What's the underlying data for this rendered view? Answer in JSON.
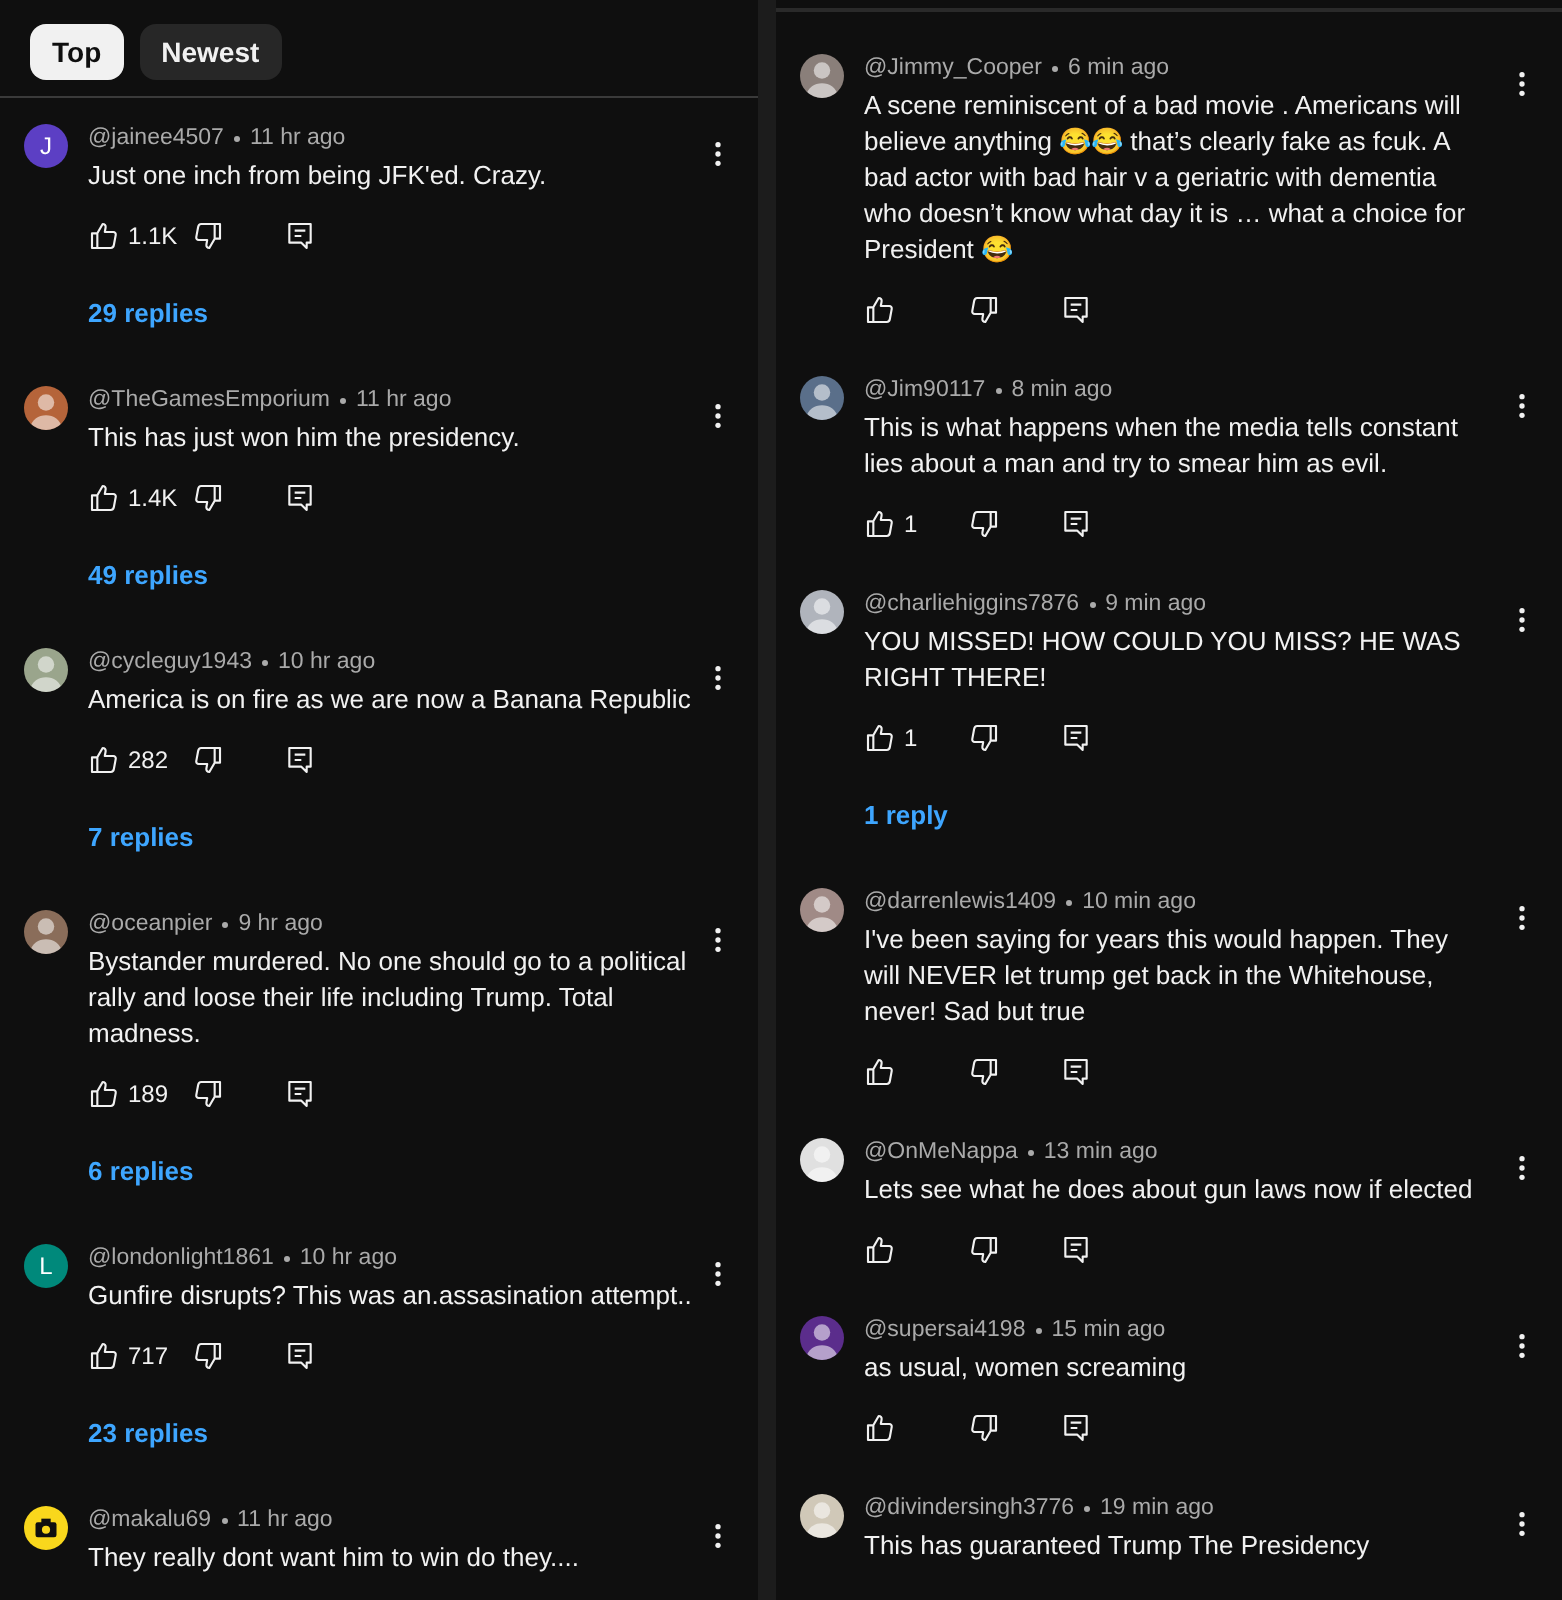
{
  "left_panel": {
    "sort_tabs": [
      {
        "label": "Top",
        "selected": true
      },
      {
        "label": "Newest",
        "selected": false
      }
    ],
    "comments": [
      {
        "author": "@jainee4507",
        "time": "11 hr ago",
        "avatar": {
          "kind": "letter",
          "letter": "J",
          "color": "#5c3fc4"
        },
        "text": "Just one inch from being JFK'ed. Crazy.",
        "likes": "1.1K",
        "replies": "29 replies"
      },
      {
        "author": "@TheGamesEmporium",
        "time": "11 hr ago",
        "avatar": {
          "kind": "photo",
          "color": "#b5643a"
        },
        "text": "This has just won him the presidency.",
        "likes": "1.4K",
        "replies": "49 replies"
      },
      {
        "author": "@cycleguy1943",
        "time": "10 hr ago",
        "avatar": {
          "kind": "photo",
          "color": "#9aa58c"
        },
        "text": "America is on fire as we are now a Banana Republic",
        "likes": "282",
        "replies": "7 replies"
      },
      {
        "author": "@oceanpier",
        "time": "9 hr ago",
        "avatar": {
          "kind": "photo",
          "color": "#8a6d5a"
        },
        "text": "Bystander murdered. No one should go to a political rally and loose their life including Trump. Total madness.",
        "likes": "189",
        "replies": "6 replies"
      },
      {
        "author": "@londonlight1861",
        "time": "10 hr ago",
        "avatar": {
          "kind": "letter",
          "letter": "L",
          "color": "#00897b"
        },
        "text": "Gunfire disrupts? This was an.assasination attempt..",
        "likes": "717",
        "replies": "23 replies"
      },
      {
        "author": "@makalu69",
        "time": "11 hr ago",
        "avatar": {
          "kind": "camera",
          "color": "#f9d71c"
        },
        "text": "They really dont want him to win do they...."
      }
    ]
  },
  "right_panel": {
    "comments": [
      {
        "author": "@Jimmy_Cooper",
        "time": "6 min ago",
        "avatar": {
          "kind": "photo",
          "color": "#8a7f7a"
        },
        "text": "A scene reminiscent of a bad movie . Americans will believe anything 😂😂 that’s clearly fake as fcuk. A bad actor with bad hair v a  geriatric with dementia who doesn’t know what day it is … what a choice for President 😂",
        "actions": true
      },
      {
        "author": "@Jim90117",
        "time": "8 min ago",
        "avatar": {
          "kind": "photo",
          "color": "#5a6f8a"
        },
        "text": "This is what happens when the media tells constant lies about a man and try to smear him as evil.",
        "likes": "1"
      },
      {
        "author": "@charliehiggins7876",
        "time": "9 min ago",
        "avatar": {
          "kind": "photo",
          "color": "#b0b4bc"
        },
        "text": "YOU MISSED! HOW COULD YOU MISS? HE WAS RIGHT THERE!",
        "likes": "1",
        "replies": "1 reply"
      },
      {
        "author": "@darrenlewis1409",
        "time": "10 min ago",
        "avatar": {
          "kind": "photo",
          "color": "#a08a86"
        },
        "text": "I've been saying for years this would happen. They will NEVER let trump get back in the Whitehouse, never! Sad but true",
        "actions": true
      },
      {
        "author": "@OnMeNappa",
        "time": "13 min ago",
        "avatar": {
          "kind": "photo",
          "color": "#e0e0e0"
        },
        "text": "Lets see what he does about gun laws now if elected",
        "actions": true
      },
      {
        "author": "@supersai4198",
        "time": "15 min ago",
        "avatar": {
          "kind": "photo",
          "color": "#5b2d8c"
        },
        "text": "as usual, women screaming",
        "actions": true
      },
      {
        "author": "@divindersingh3776",
        "time": "19 min ago",
        "avatar": {
          "kind": "photo",
          "color": "#d0c8b8"
        },
        "text": "This has guaranteed Trump The Presidency"
      }
    ]
  }
}
